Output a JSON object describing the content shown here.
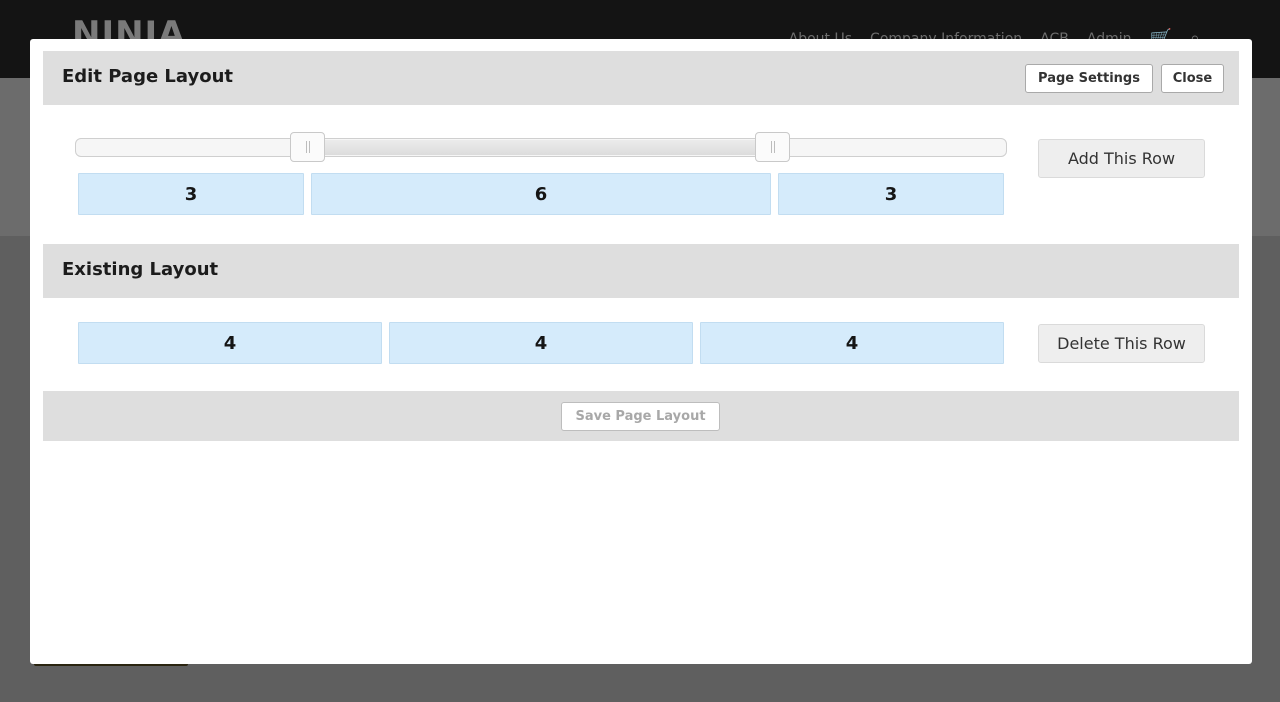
{
  "site": {
    "logo": "NINJA",
    "nav": [
      "About Us",
      "Company Information",
      "ACB",
      "Admin"
    ],
    "icons": {
      "cart": "cart-icon",
      "search": "search-icon"
    }
  },
  "modal": {
    "title": "Edit Page Layout",
    "page_settings_label": "Page Settings",
    "close_label": "Close",
    "new_row": {
      "columns": [
        "3",
        "6",
        "3"
      ],
      "add_label": "Add This Row"
    },
    "existing": {
      "title": "Existing Layout",
      "columns": [
        "4",
        "4",
        "4"
      ],
      "delete_label": "Delete This Row"
    },
    "save_label": "Save Page Layout"
  },
  "colors": {
    "overlay": "#5f5f5f",
    "column_fill": "#d5ebfb",
    "bar": "#dedede"
  }
}
